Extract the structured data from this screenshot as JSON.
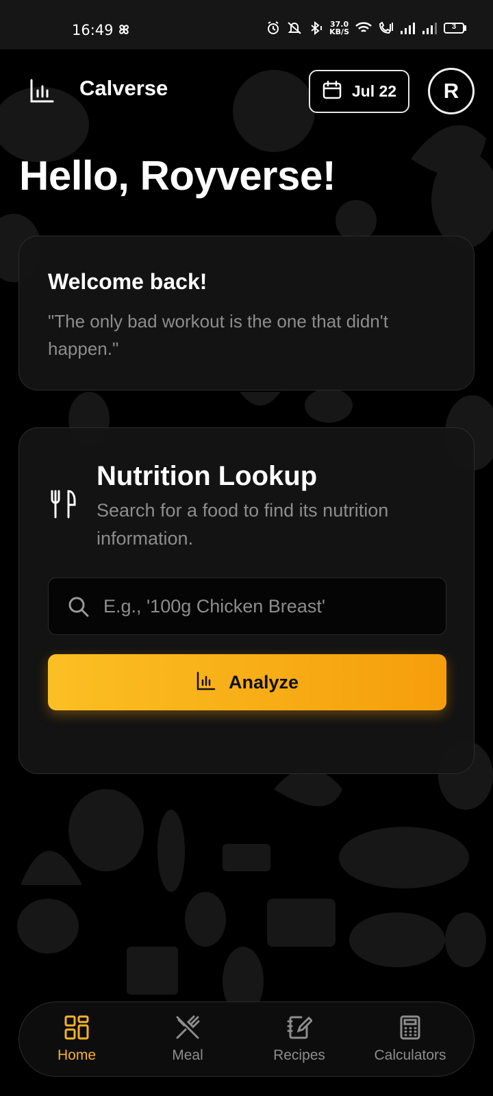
{
  "status_bar": {
    "time": "16:49",
    "speed_value": "37.0",
    "speed_unit": "KB/S",
    "battery": "3"
  },
  "header": {
    "app_title": "Calverse",
    "date_label": "Jul 22",
    "avatar_initial": "R"
  },
  "greeting": "Hello, Royverse!",
  "welcome_card": {
    "title": "Welcome back!",
    "quote": "\"The only bad workout is the one that didn't happen.\""
  },
  "nutrition_card": {
    "title": "Nutrition Lookup",
    "subtitle": "Search for a food to find its nutrition information.",
    "search_placeholder": "E.g., '100g Chicken Breast'",
    "search_value": "",
    "analyze_label": "Analyze"
  },
  "bottom_nav": {
    "items": [
      {
        "label": "Home",
        "icon": "grid-icon",
        "active": true
      },
      {
        "label": "Meal",
        "icon": "utensils-crossed-icon",
        "active": false
      },
      {
        "label": "Recipes",
        "icon": "notebook-pen-icon",
        "active": false
      },
      {
        "label": "Calculators",
        "icon": "calculator-icon",
        "active": false
      }
    ]
  },
  "colors": {
    "accent": "#f5b324",
    "button_gradient_start": "#fbbf24",
    "button_gradient_end": "#f59e0b",
    "muted_text": "#8d8d8d",
    "card_bg": "#141414"
  }
}
